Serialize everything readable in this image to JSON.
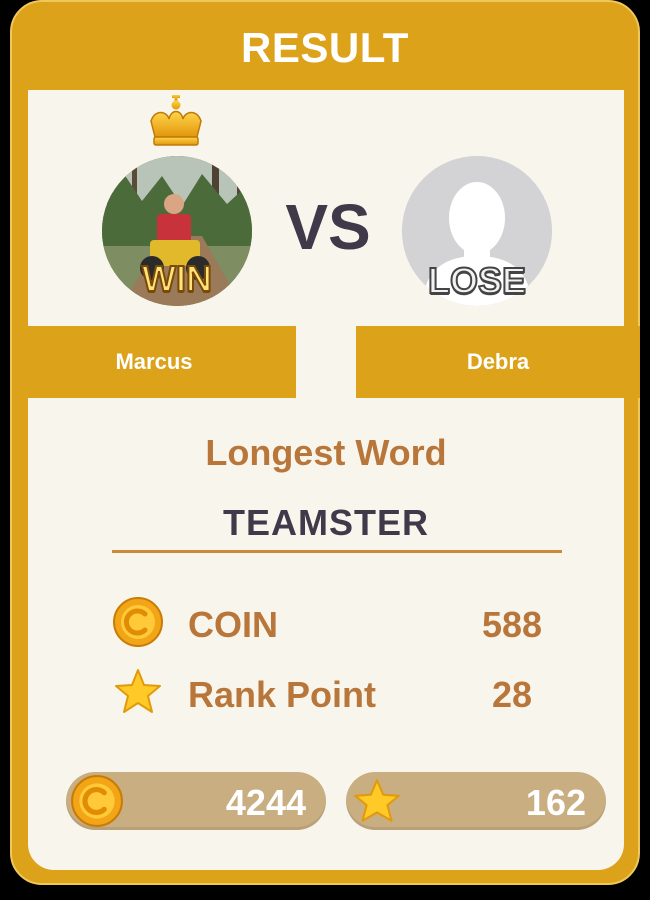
{
  "header": {
    "title": "RESULT"
  },
  "match": {
    "winner": {
      "name": "Marcus",
      "badge": "WIN",
      "avatar": "player-photo"
    },
    "loser": {
      "name": "Debra",
      "badge": "LOSE",
      "avatar": "default-silhouette"
    },
    "vs_label": "VS"
  },
  "longest_word": {
    "label": "Longest Word",
    "word": "TEAMSTER"
  },
  "rewards": [
    {
      "icon": "coin-icon",
      "label": "COIN",
      "value": "588"
    },
    {
      "icon": "star-icon",
      "label": "Rank Point",
      "value": "28"
    }
  ],
  "totals": {
    "coins": {
      "icon": "coin-icon",
      "value": "4244"
    },
    "rank_points": {
      "icon": "star-icon",
      "value": "162"
    }
  },
  "colors": {
    "frame": "#dca21a",
    "panel": "#f8f6ec",
    "accent_text": "#b8763a",
    "dark_text": "#3f3a4a",
    "pill": "#c9ae82"
  }
}
